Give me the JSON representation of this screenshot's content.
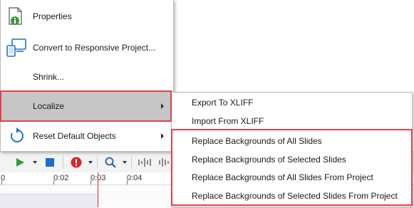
{
  "context_menu": {
    "items": [
      {
        "label": "Properties",
        "icon": "properties-info-icon"
      },
      {
        "label": "Convert to Responsive Project...",
        "icon": "responsive-devices-icon"
      },
      {
        "label": "Shrink..."
      },
      {
        "label": "Localize",
        "has_submenu": true,
        "highlighted": true
      },
      {
        "label": "Reset Default Objects",
        "icon": "reset-arrow-icon",
        "has_submenu": true
      }
    ]
  },
  "localize_submenu": {
    "items": [
      {
        "label": "Export To XLIFF"
      },
      {
        "label": "Import From XLIFF"
      },
      {
        "label": "Replace Backgrounds of All Slides"
      },
      {
        "label": "Replace Backgrounds of Selected Slides"
      },
      {
        "label": "Replace Backgrounds of All Slides From Project"
      },
      {
        "label": "Replace Backgrounds of Selected Slides From Project"
      }
    ]
  },
  "timeline": {
    "ticks": [
      "0",
      "0:02",
      "0:03",
      "0:04"
    ]
  },
  "colors": {
    "annotation": "#e0434b",
    "menu_highlight": "#c6c6c6",
    "play_green": "#2e9e3e",
    "stop_blue": "#1d6fc9",
    "info_green": "#3c9a3c",
    "device_blue": "#1e73be",
    "playhead_red": "#d4232b"
  },
  "icons": {
    "toolbar": [
      "play-icon",
      "stop-icon",
      "error-badge-icon",
      "zoom-icon",
      "waveform-icon"
    ]
  }
}
